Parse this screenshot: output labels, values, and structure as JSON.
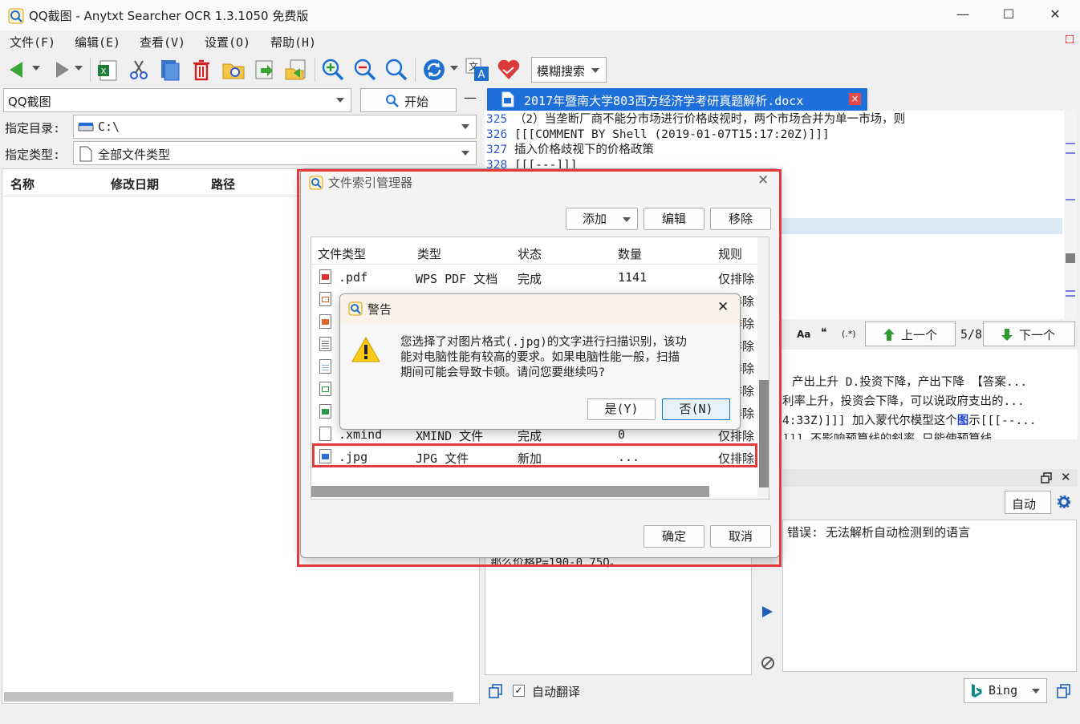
{
  "window": {
    "title": "QQ截图 - Anytxt Searcher OCR 1.3.1050 免费版",
    "minimize": "—",
    "maximize": "☐",
    "close": "✕"
  },
  "menu": [
    "文件(F)",
    "编辑(E)",
    "查看(V)",
    "设置(O)",
    "帮助(H)"
  ],
  "toolbar": {
    "search_mode": "模糊搜索"
  },
  "search": {
    "query": "QQ截图",
    "start_label": "开始",
    "collapse": "—",
    "dir_label": "指定目录:",
    "dir_value": "C:\\",
    "type_label": "指定类型:",
    "type_value": "全部文件类型"
  },
  "results": {
    "headers": [
      "名称",
      "修改日期",
      "路径"
    ]
  },
  "doc_tab": {
    "title": "2017年暨南大学803西方经济学考研真题解析.docx",
    "close": "×"
  },
  "doc_lines": [
    {
      "no": "325",
      "text": "（2）当垄断厂商不能分市场进行价格歧视时，两个市场合并为单一市场，则"
    },
    {
      "no": "326",
      "text": "[[[COMMENT BY Shell (2019-01-07T15:17:20Z)]]]"
    },
    {
      "no": "327",
      "text": "插入价格歧视下的价格政策"
    },
    {
      "no": "328",
      "text": "[[[---]]]"
    }
  ],
  "find_bar": {
    "aa": "Aa",
    "quote": "❝",
    "regex": "(.*)",
    "prev": "上一个",
    "count": "5/8",
    "next": "下一个"
  },
  "snippets": [
    "产出上升 D.投资下降，产出下降 【答案...",
    "利率上升，投资会下降，可以说政府支出的...",
    "4:33Z)]]] 加入蒙代尔模型这个",
    "]]] 不影响预算线的斜率 只能使预算线"
  ],
  "snippet_highlight": "图",
  "snippet_tail": "示[[[--...",
  "translate": {
    "mode": "自动",
    "error": "错误: 无法解析自动检测到的语言",
    "source_text": "那么价格P=190-0.75Q。",
    "auto_translate": "自动翻译",
    "engine": "Bing"
  },
  "index_manager": {
    "title": "文件索引管理器",
    "add": "添加",
    "edit": "编辑",
    "remove": "移除",
    "headers": [
      "文件类型",
      "类型",
      "状态",
      "数量",
      "规则"
    ],
    "rows": [
      {
        "ext": ".pdf",
        "type": "WPS PDF 文档",
        "status": "完成",
        "count": "1141",
        "rule": "仅排除"
      },
      {
        "ext": "",
        "type": "",
        "status": "",
        "count": "",
        "rule": "仅排除"
      },
      {
        "ext": "",
        "type": "",
        "status": "",
        "count": "",
        "rule": "仅排除"
      },
      {
        "ext": "",
        "type": "",
        "status": "",
        "count": "",
        "rule": "仅排除"
      },
      {
        "ext": "",
        "type": "",
        "status": "",
        "count": "",
        "rule": "仅排除"
      },
      {
        "ext": "",
        "type": "",
        "status": "",
        "count": "",
        "rule": "仅排除"
      },
      {
        "ext": "",
        "type": "",
        "status": "",
        "count": "",
        "rule": "仅排除"
      },
      {
        "ext": ".xmind",
        "type": "XMIND 文件",
        "status": "完成",
        "count": "0",
        "rule": "仅排除"
      },
      {
        "ext": ".jpg",
        "type": "JPG 文件",
        "status": "新加",
        "count": "...",
        "rule": "仅排除"
      }
    ],
    "ok": "确定",
    "cancel": "取消"
  },
  "warning": {
    "title": "警告",
    "message_lines": [
      "您选择了对图片格式(.jpg)的文字进行扫描识别，该功",
      "能对电脑性能有较高的要求。如果电脑性能一般，扫描",
      "期间可能会导致卡顿。请问您要继续吗?"
    ],
    "yes": "是(Y)",
    "no": "否(N)",
    "close": "✕"
  },
  "colors": {
    "accent": "#0078d4",
    "tab_blue": "#1e6fd9",
    "highlight_red": "#e23b3b",
    "selection": "#dbe9f7"
  }
}
